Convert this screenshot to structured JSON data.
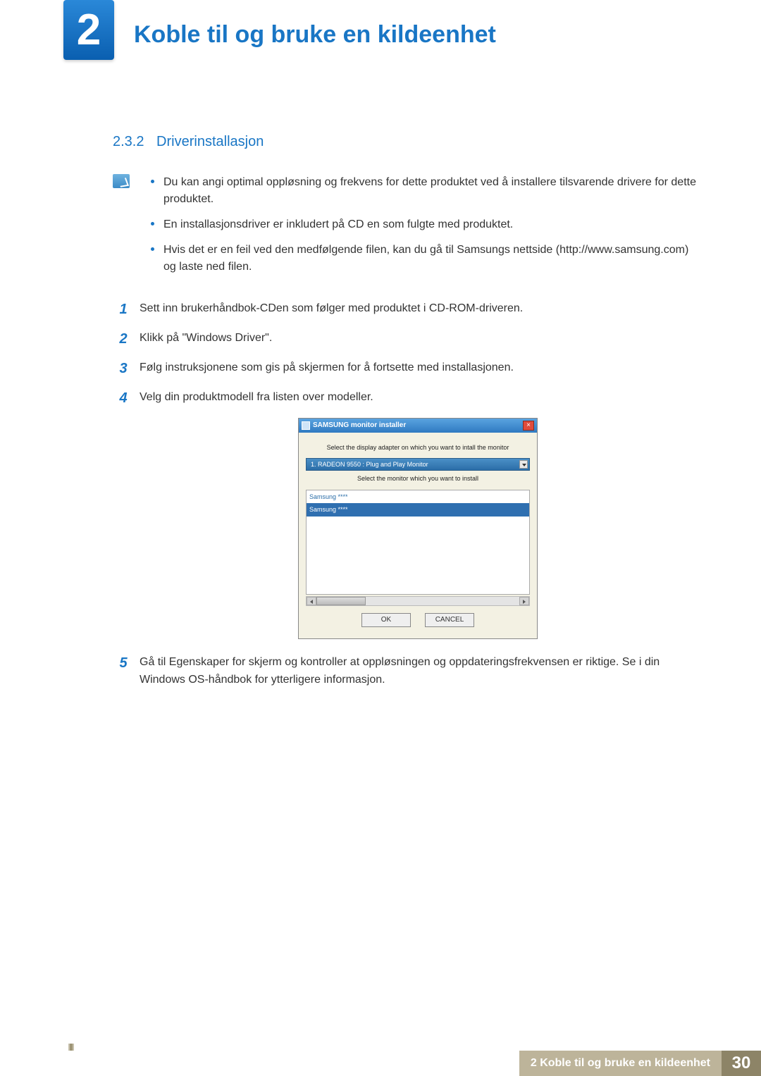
{
  "chapter": {
    "number": "2",
    "title": "Koble til og bruke en kildeenhet"
  },
  "subsection": {
    "number": "2.3.2",
    "title": "Driverinstallasjon"
  },
  "notes": [
    "Du kan angi optimal oppløsning og frekvens for dette produktet ved å installere tilsvarende drivere for dette produktet.",
    "En installasjonsdriver er inkludert på CD en som fulgte med produktet.",
    "Hvis det er en feil ved den medfølgende filen, kan du gå til Samsungs nettside (http://www.samsung.com) og laste ned filen."
  ],
  "steps": [
    {
      "n": "1",
      "text": "Sett inn brukerhåndbok-CDen som følger med produktet i CD-ROM-driveren."
    },
    {
      "n": "2",
      "text": "Klikk på \"Windows Driver\"."
    },
    {
      "n": "3",
      "text": "Følg instruksjonene som gis på skjermen for å fortsette med installasjonen."
    },
    {
      "n": "4",
      "text": "Velg din produktmodell fra listen over modeller."
    },
    {
      "n": "5",
      "text": "Gå til Egenskaper for skjerm og kontroller at oppløsningen og oppdateringsfrekvensen er riktige. Se i din Windows OS-håndbok for ytterligere informasjon."
    }
  ],
  "dialog": {
    "title": "SAMSUNG monitor installer",
    "label1": "Select the display adapter on which you want to intall the monitor",
    "adapter": "1. RADEON 9550 : Plug and Play Monitor",
    "label2": "Select the monitor which you want to install",
    "list": [
      "Samsung ****",
      "Samsung ****"
    ],
    "ok": "OK",
    "cancel": "CANCEL"
  },
  "footer": {
    "title": "2 Koble til og bruke en kildeenhet",
    "page": "30"
  }
}
